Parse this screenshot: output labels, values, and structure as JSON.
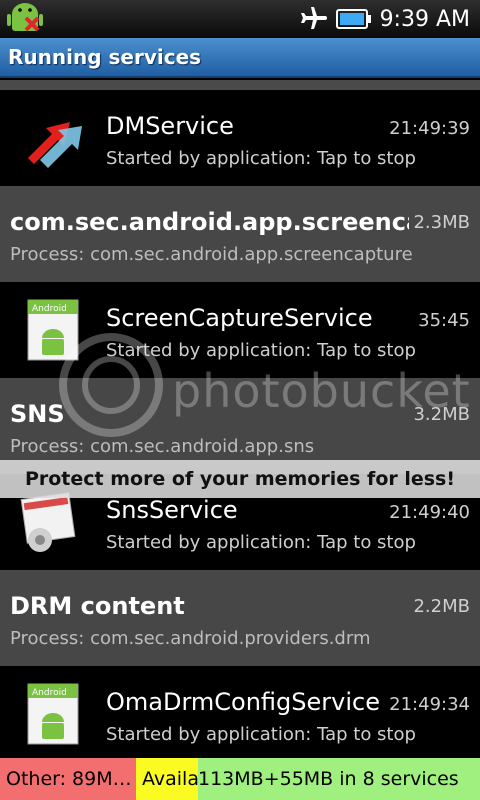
{
  "status": {
    "time": "9:39 AM"
  },
  "header": {
    "title": "Running services"
  },
  "rows": [
    {
      "type": "service",
      "name": "DMService",
      "subtitle": "Started by application: Tap to stop",
      "right": "21:49:39",
      "icon": "dm-arrows-icon"
    },
    {
      "type": "process",
      "name": "com.sec.android.app.screencapture",
      "subtitle": "Process: com.sec.android.app.screencapture",
      "right": "2.3MB"
    },
    {
      "type": "service",
      "name": "ScreenCaptureService",
      "subtitle": "Started by application: Tap to stop",
      "right": "35:45",
      "icon": "android-app-icon",
      "icon_label": "Android"
    },
    {
      "type": "process",
      "name": "SNS",
      "subtitle": "Process: com.sec.android.app.sns",
      "right": "3.2MB"
    },
    {
      "type": "service",
      "name": "SnsService",
      "subtitle": "Started by application: Tap to stop",
      "right": "21:49:40",
      "icon": "sns-settings-icon"
    },
    {
      "type": "process",
      "name": "DRM content",
      "subtitle": "Process: com.sec.android.providers.drm",
      "right": "2.2MB"
    },
    {
      "type": "service",
      "name": "OmaDrmConfigService",
      "subtitle": "Started by application: Tap to stop",
      "right": "21:49:34",
      "icon": "android-app-icon",
      "icon_label": "Android"
    }
  ],
  "overlay": {
    "watermark": "photobucket",
    "banner": "Protect more of your memories for less!"
  },
  "footer": {
    "other": "Other: 89M…",
    "available": "Available: ",
    "free": "113MB+55MB in 8 services",
    "colors": {
      "other": "#f36f6f",
      "available": "#fbfb24",
      "free": "#9ff07e"
    }
  }
}
